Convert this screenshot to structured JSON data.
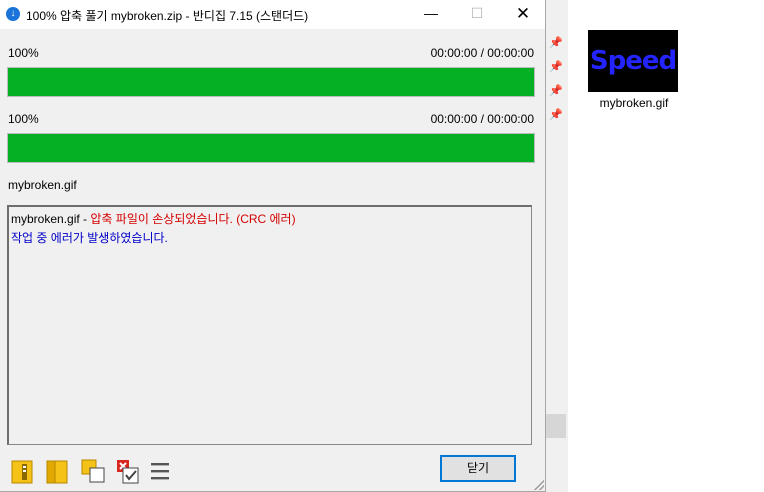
{
  "window": {
    "title": "100% 압축 풀기 mybroken.zip - 반디집 7.15 (스탠더드)",
    "minimize_glyph": "—",
    "maximize_glyph": "☐",
    "close_glyph": "✕"
  },
  "progress": [
    {
      "percent_label": "100%",
      "time_label": "00:00:00 / 00:00:00",
      "fill": 1.0
    },
    {
      "percent_label": "100%",
      "time_label": "00:00:00 / 00:00:00",
      "fill": 1.0
    }
  ],
  "current_file": "mybroken.gif",
  "log": {
    "line1_file": "mybroken.gif",
    "line1_sep": " - ",
    "line1_error": "압축 파일이 손상되었습니다. (CRC 에러)",
    "line2": "작업 중 에러가 발생하였습니다."
  },
  "toolbar": {
    "close_button": "닫기",
    "icons": [
      "open-folder-icon",
      "folder-icon",
      "copy-icon",
      "checklist-icon",
      "menu-icon"
    ]
  },
  "desktop_file": {
    "name": "mybroken.gif",
    "thumbnail_text": "Speed"
  },
  "colors": {
    "progress_fill": "#06b025",
    "error_red": "#d40000",
    "error_blue": "#0000c8",
    "accent": "#0078d7"
  }
}
